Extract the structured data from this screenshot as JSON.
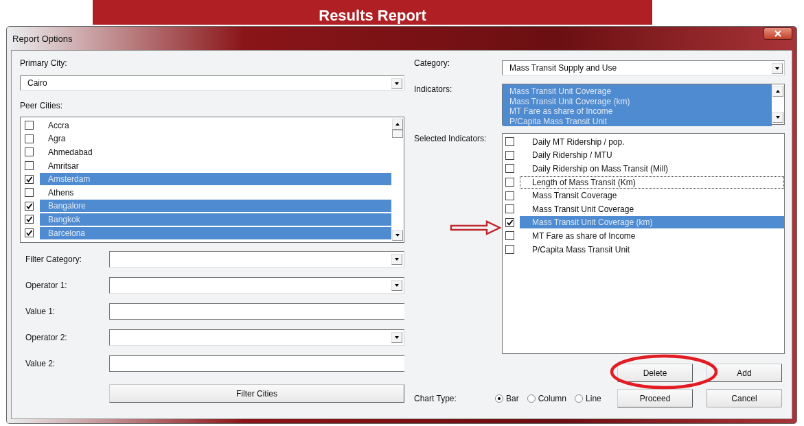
{
  "background": {
    "title": "Results Report"
  },
  "window": {
    "title": "Report Options"
  },
  "primary_city": {
    "label": "Primary City:",
    "value": "Cairo"
  },
  "peer_cities": {
    "label": "Peer Cities:",
    "items": [
      {
        "label": "Accra",
        "checked": false,
        "selected": false
      },
      {
        "label": "Agra",
        "checked": false,
        "selected": false
      },
      {
        "label": "Ahmedabad",
        "checked": false,
        "selected": false
      },
      {
        "label": "Amritsar",
        "checked": false,
        "selected": false
      },
      {
        "label": "Amsterdam",
        "checked": true,
        "selected": true
      },
      {
        "label": "Athens",
        "checked": false,
        "selected": false
      },
      {
        "label": "Bangalore",
        "checked": true,
        "selected": true
      },
      {
        "label": "Bangkok",
        "checked": true,
        "selected": true
      },
      {
        "label": "Barcelona",
        "checked": true,
        "selected": true
      }
    ]
  },
  "filters": [
    {
      "label": "Filter Category:",
      "kind": "dropdown"
    },
    {
      "label": "Operator 1:",
      "kind": "dropdown"
    },
    {
      "label": "Value 1:",
      "kind": "text"
    },
    {
      "label": "Operator 2:",
      "kind": "dropdown"
    },
    {
      "label": "Value 2:",
      "kind": "text"
    }
  ],
  "filter_button": "Filter Cities",
  "category": {
    "label": "Category:",
    "value": "Mass Transit Supply and Use"
  },
  "indicators": {
    "label": "Indicators:",
    "items": [
      {
        "label": "Mass Transit Unit Coverage",
        "selected": true
      },
      {
        "label": "Mass Transit Unit Coverage (km)",
        "selected": true
      },
      {
        "label": "MT Fare as share of Income",
        "selected": true
      },
      {
        "label": "P/Capita Mass Transit Unit",
        "selected": true
      }
    ]
  },
  "selected_indicators": {
    "label": "Selected Indicators:",
    "items": [
      {
        "label": "Daily MT Ridership / pop.",
        "checked": false,
        "selected": false,
        "focused": false
      },
      {
        "label": "Daily Ridership / MTU",
        "checked": false,
        "selected": false,
        "focused": false
      },
      {
        "label": "Daily Ridership on Mass Transit (Mill)",
        "checked": false,
        "selected": false,
        "focused": false
      },
      {
        "label": "Length of Mass Transit (Km)",
        "checked": false,
        "selected": false,
        "focused": true
      },
      {
        "label": "Mass Transit Coverage",
        "checked": false,
        "selected": false,
        "focused": false
      },
      {
        "label": "Mass Transit Unit Coverage",
        "checked": false,
        "selected": false,
        "focused": false
      },
      {
        "label": "Mass Transit Unit Coverage (km)",
        "checked": true,
        "selected": true,
        "focused": false
      },
      {
        "label": "MT Fare as share of Income",
        "checked": false,
        "selected": false,
        "focused": false
      },
      {
        "label": "P/Capita Mass Transit Unit",
        "checked": false,
        "selected": false,
        "focused": false
      }
    ]
  },
  "chart_type": {
    "label": "Chart Type:",
    "options": [
      {
        "label": "Bar",
        "selected": true
      },
      {
        "label": "Column",
        "selected": false
      },
      {
        "label": "Line",
        "selected": false
      }
    ]
  },
  "buttons": [
    {
      "label": "Delete"
    },
    {
      "label": "Add"
    },
    {
      "label": "Proceed"
    },
    {
      "label": "Cancel"
    }
  ]
}
